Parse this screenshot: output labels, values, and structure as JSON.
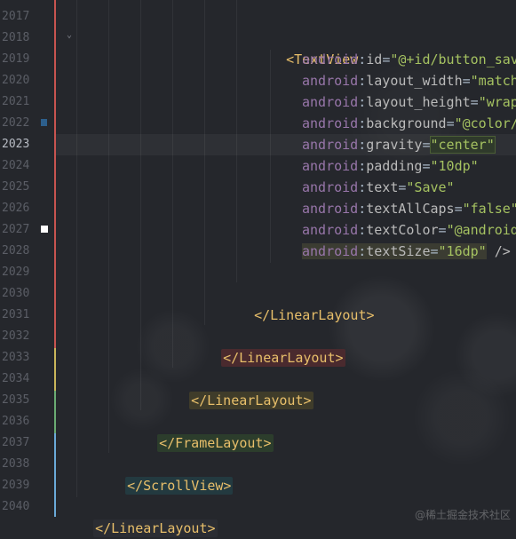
{
  "editor": {
    "line_numbers": [
      "2017",
      "2018",
      "2019",
      "2020",
      "2021",
      "2022",
      "2023",
      "2024",
      "2025",
      "2026",
      "2027",
      "2028",
      "2029",
      "2030",
      "2031",
      "2032",
      "2033",
      "2034",
      "2035",
      "2036",
      "2037",
      "2038",
      "2039",
      "2040"
    ],
    "current_line": "2023",
    "lines": {
      "textview_open": "<TextView",
      "attrs": [
        {
          "prefix": "android",
          "name": "id",
          "value": "\"@+id/button_sav"
        },
        {
          "prefix": "android",
          "name": "layout_width",
          "value": "\"match"
        },
        {
          "prefix": "android",
          "name": "layout_height",
          "value": "\"wrap"
        },
        {
          "prefix": "android",
          "name": "background",
          "value": "\"@color/"
        },
        {
          "prefix": "android",
          "name": "gravity",
          "value": "\"center\""
        },
        {
          "prefix": "android",
          "name": "padding",
          "value": "\"10dp\""
        },
        {
          "prefix": "android",
          "name": "text",
          "value": "\"Save\""
        },
        {
          "prefix": "android",
          "name": "textAllCaps",
          "value": "\"false\""
        },
        {
          "prefix": "android",
          "name": "textColor",
          "value": "\"@android"
        },
        {
          "prefix": "android",
          "name": "textSize",
          "value": "\"16dp\"",
          "suffix": " />"
        }
      ],
      "close_linear_1": "</LinearLayout>",
      "close_linear_2": "</LinearLayout>",
      "close_linear_3": "</LinearLayout>",
      "close_frame": "</FrameLayout>",
      "close_scroll": "</ScrollView>",
      "close_linear_root": "</LinearLayout>"
    }
  },
  "colors": {
    "background": "#25272c",
    "tag": "#e8bf6a",
    "attr_prefix": "#9876aa",
    "attr_value": "#a5c261",
    "vcs_bar_red": "#c75450",
    "vcs_bar_yellow": "#c9b55a",
    "vcs_bar_green": "#6aab73",
    "vcs_bar_blue": "#6aa9d8"
  },
  "watermark": "@稀土掘金技术社区"
}
